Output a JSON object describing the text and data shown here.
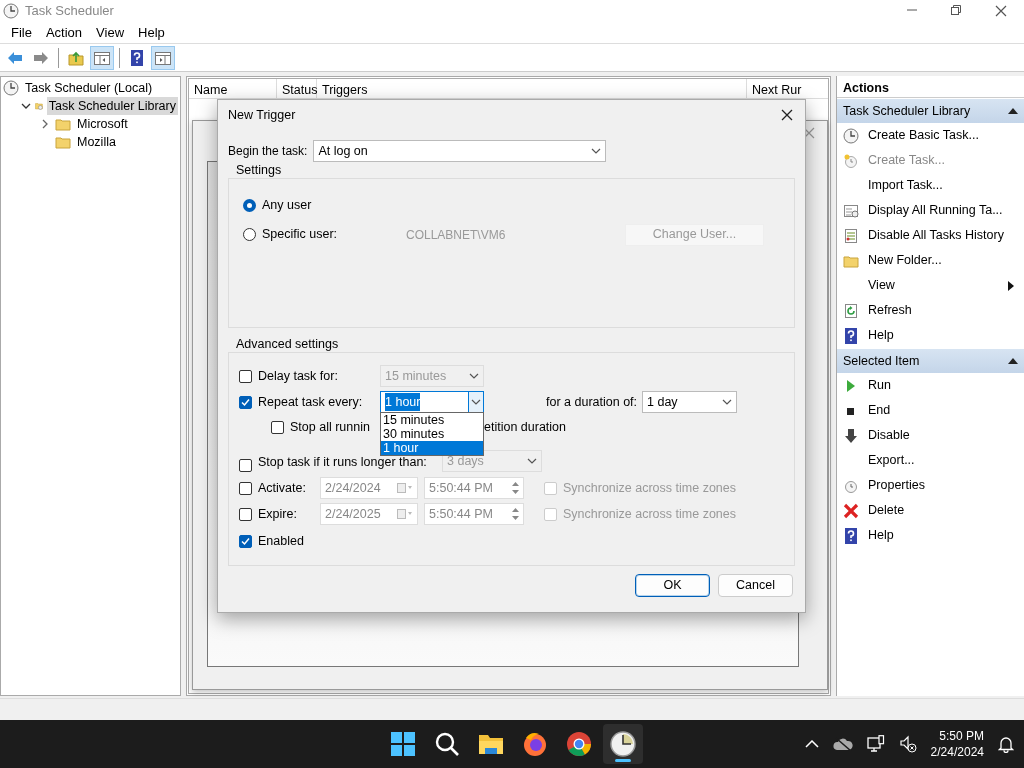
{
  "window": {
    "title": "Task Scheduler"
  },
  "menu": [
    "File",
    "Action",
    "View",
    "Help"
  ],
  "toolbar": [
    {
      "kind": "back",
      "pressed": false
    },
    {
      "kind": "forward",
      "pressed": false
    },
    {
      "kind": "separator"
    },
    {
      "kind": "up",
      "pressed": false
    },
    {
      "kind": "tree",
      "pressed": true
    },
    {
      "kind": "separator"
    },
    {
      "kind": "help",
      "pressed": false
    },
    {
      "kind": "pane",
      "pressed": true
    }
  ],
  "tree": [
    {
      "label": "Task Scheduler (Local)",
      "selected": false,
      "children": [
        {
          "label": "Task Scheduler Library",
          "selected": true,
          "expanded": true,
          "children": [
            {
              "label": "Microsoft",
              "selected": false,
              "expanded": false
            },
            {
              "label": "Mozilla",
              "selected": false
            }
          ]
        }
      ]
    }
  ],
  "task_list": {
    "columns": [
      "Name",
      "Status",
      "Triggers",
      "Next Rur"
    ]
  },
  "dialog": {
    "title": "New Trigger",
    "begin_label": "Begin the task:",
    "begin_value": "At log on",
    "settings_title": "Settings",
    "users": [
      {
        "label": "Any user",
        "selected": true
      },
      {
        "label": "Specific user:",
        "selected": false
      }
    ],
    "user_name": "COLLABNET\\VM6",
    "change_user": {
      "label": "Change User...",
      "disabled": true
    },
    "advanced_title": "Advanced settings",
    "delay": {
      "label": "Delay task for:",
      "checked": false,
      "value": "15 minutes"
    },
    "repeat": {
      "label": "Repeat task every:",
      "checked": true,
      "value": "1 hour",
      "options": [
        {
          "label": "15 minutes",
          "selected": false
        },
        {
          "label": "30 minutes",
          "selected": false
        },
        {
          "label": "1 hour",
          "selected": true
        }
      ],
      "duration_label": "for a duration of:",
      "duration_value": "1 day"
    },
    "stop_all": {
      "label_start": "Stop all runnin",
      "label_end": "etition duration",
      "checked": false
    },
    "stop_longer": {
      "label": "Stop task if it runs longer than:",
      "checked": false,
      "value": "3 days"
    },
    "dates": [
      {
        "label": "Activate:",
        "checked": false,
        "date": "2/24/2024",
        "time": "5:50:44 PM",
        "sync_label": "Synchronize across time zones",
        "sync_checked": false
      },
      {
        "label": "Expire:",
        "checked": false,
        "date": "2/24/2025",
        "time": "5:50:44 PM",
        "sync_label": "Synchronize across time zones",
        "sync_checked": false
      }
    ],
    "enabled": {
      "label": "Enabled",
      "checked": true
    },
    "buttons": [
      {
        "label": "OK",
        "default": true
      },
      {
        "label": "Cancel",
        "default": false
      }
    ]
  },
  "actions": {
    "title": "Actions",
    "sections": [
      {
        "title": "Task Scheduler Library",
        "expanded": true,
        "items": [
          {
            "label": "Create Basic Task...",
            "kind": "create-basic",
            "disabled": false
          },
          {
            "label": "Create Task...",
            "kind": "create",
            "disabled": true
          },
          {
            "label": "Import Task...",
            "kind": "none",
            "disabled": false
          },
          {
            "label": "Display All Running Ta...",
            "kind": "running",
            "disabled": false
          },
          {
            "label": "Disable All Tasks History",
            "kind": "history",
            "disabled": false
          },
          {
            "label": "New Folder...",
            "kind": "folder",
            "disabled": false
          },
          {
            "label": "View",
            "kind": "none",
            "disabled": false,
            "submenu": true
          },
          {
            "label": "Refresh",
            "kind": "refresh",
            "disabled": false
          },
          {
            "label": "Help",
            "kind": "help",
            "disabled": false
          }
        ]
      },
      {
        "title": "Selected Item",
        "expanded": true,
        "items": [
          {
            "label": "Run",
            "kind": "run",
            "disabled": false
          },
          {
            "label": "End",
            "kind": "end",
            "disabled": false
          },
          {
            "label": "Disable",
            "kind": "disable",
            "disabled": false
          },
          {
            "label": "Export...",
            "kind": "none",
            "disabled": false
          },
          {
            "label": "Properties",
            "kind": "properties",
            "disabled": false
          },
          {
            "label": "Delete",
            "kind": "delete",
            "disabled": false
          },
          {
            "label": "Help",
            "kind": "help",
            "disabled": false
          }
        ]
      }
    ]
  },
  "taskbar": {
    "apps": [
      {
        "kind": "start",
        "active": false
      },
      {
        "kind": "search",
        "active": false
      },
      {
        "kind": "explorer",
        "active": false
      },
      {
        "kind": "firefox",
        "active": false
      },
      {
        "kind": "chrome",
        "active": false
      },
      {
        "kind": "scheduler",
        "active": true
      }
    ],
    "time": "5:50 PM",
    "date": "2/24/2024"
  }
}
